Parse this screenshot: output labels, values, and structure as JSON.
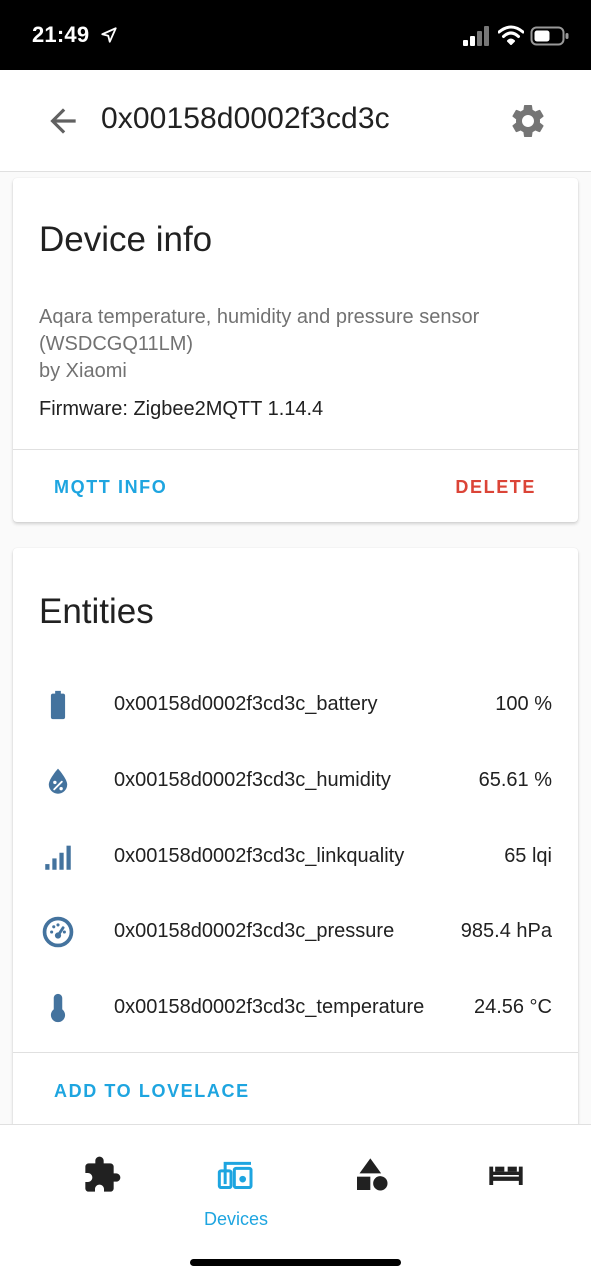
{
  "status_bar": {
    "time": "21:49"
  },
  "header": {
    "title": "0x00158d0002f3cd3c",
    "back_icon": "arrow-left-icon",
    "settings_icon": "gear-icon"
  },
  "device_info": {
    "title": "Device info",
    "model_line1": "Aqara temperature, humidity and pressure sensor",
    "model_line2": "(WSDCGQ11LM)",
    "manufacturer": "by Xiaomi",
    "firmware": "Firmware: Zigbee2MQTT 1.14.4",
    "mqtt_info_label": "MQTT INFO",
    "delete_label": "DELETE"
  },
  "entities": {
    "title": "Entities",
    "items": [
      {
        "name": "0x00158d0002f3cd3c_battery",
        "value": "100 %",
        "icon": "battery-icon"
      },
      {
        "name": "0x00158d0002f3cd3c_humidity",
        "value": "65.61 %",
        "icon": "water-percent-icon"
      },
      {
        "name": "0x00158d0002f3cd3c_linkquality",
        "value": "65 lqi",
        "icon": "signal-icon"
      },
      {
        "name": "0x00158d0002f3cd3c_pressure",
        "value": "985.4 hPa",
        "icon": "gauge-icon"
      },
      {
        "name": "0x00158d0002f3cd3c_temperature",
        "value": "24.56 °C",
        "icon": "thermometer-icon"
      }
    ],
    "add_to_lovelace_label": "ADD TO LOVELACE"
  },
  "bottom_nav": {
    "items": [
      {
        "icon": "puzzle-icon",
        "label": ""
      },
      {
        "icon": "devices-icon",
        "label": "Devices",
        "active": true
      },
      {
        "icon": "shapes-icon",
        "label": ""
      },
      {
        "icon": "sofa-icon",
        "label": ""
      }
    ]
  },
  "colors": {
    "accent": "#1ea5e0",
    "danger": "#db4437",
    "entity_icon": "#44739e",
    "text": "#212121",
    "secondary_text": "#727272"
  }
}
